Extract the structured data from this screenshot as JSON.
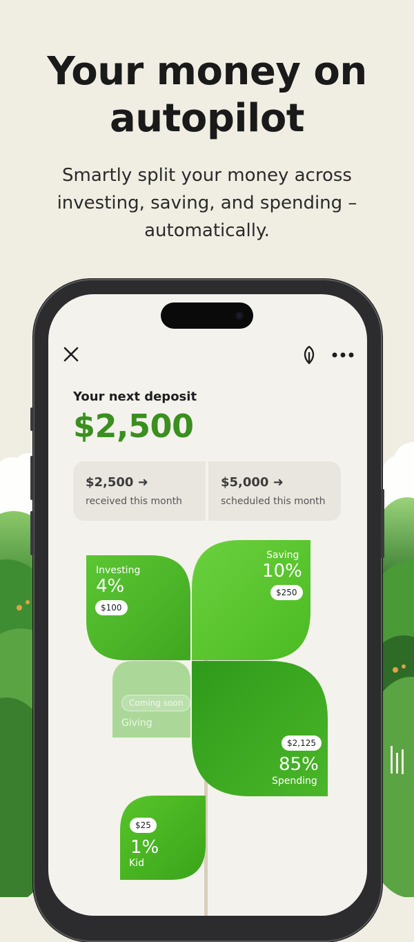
{
  "headline": {
    "line1": "Your money on",
    "line2": "autopilot"
  },
  "subheadline": {
    "line1": "Smartly split your money across",
    "line2": "investing, saving, and spending –",
    "line3": "automatically."
  },
  "app": {
    "toolbar": {
      "close_icon": "close-icon",
      "leaf_icon": "leaf-icon",
      "more_icon": "more-icon"
    },
    "next_deposit": {
      "label": "Your next deposit",
      "amount": "$2,500"
    },
    "stats": [
      {
        "value": "$2,500 ➜",
        "label": "received this month"
      },
      {
        "value": "$5,000 ➜",
        "label": "scheduled this month"
      }
    ],
    "allocations": {
      "investing": {
        "name": "Investing",
        "percent": "4%",
        "amount": "$100"
      },
      "saving": {
        "name": "Saving",
        "percent": "10%",
        "amount": "$250"
      },
      "giving": {
        "name": "Giving",
        "badge": "Coming soon"
      },
      "spending": {
        "name": "Spending",
        "percent": "85%",
        "amount": "$2,125"
      },
      "kid": {
        "name": "Kid",
        "percent": "1%",
        "amount": "$25"
      }
    },
    "colors": {
      "accent_green": "#3a8f1e",
      "leaf_green": "#4cbc22",
      "background": "#f4f2ed"
    }
  }
}
